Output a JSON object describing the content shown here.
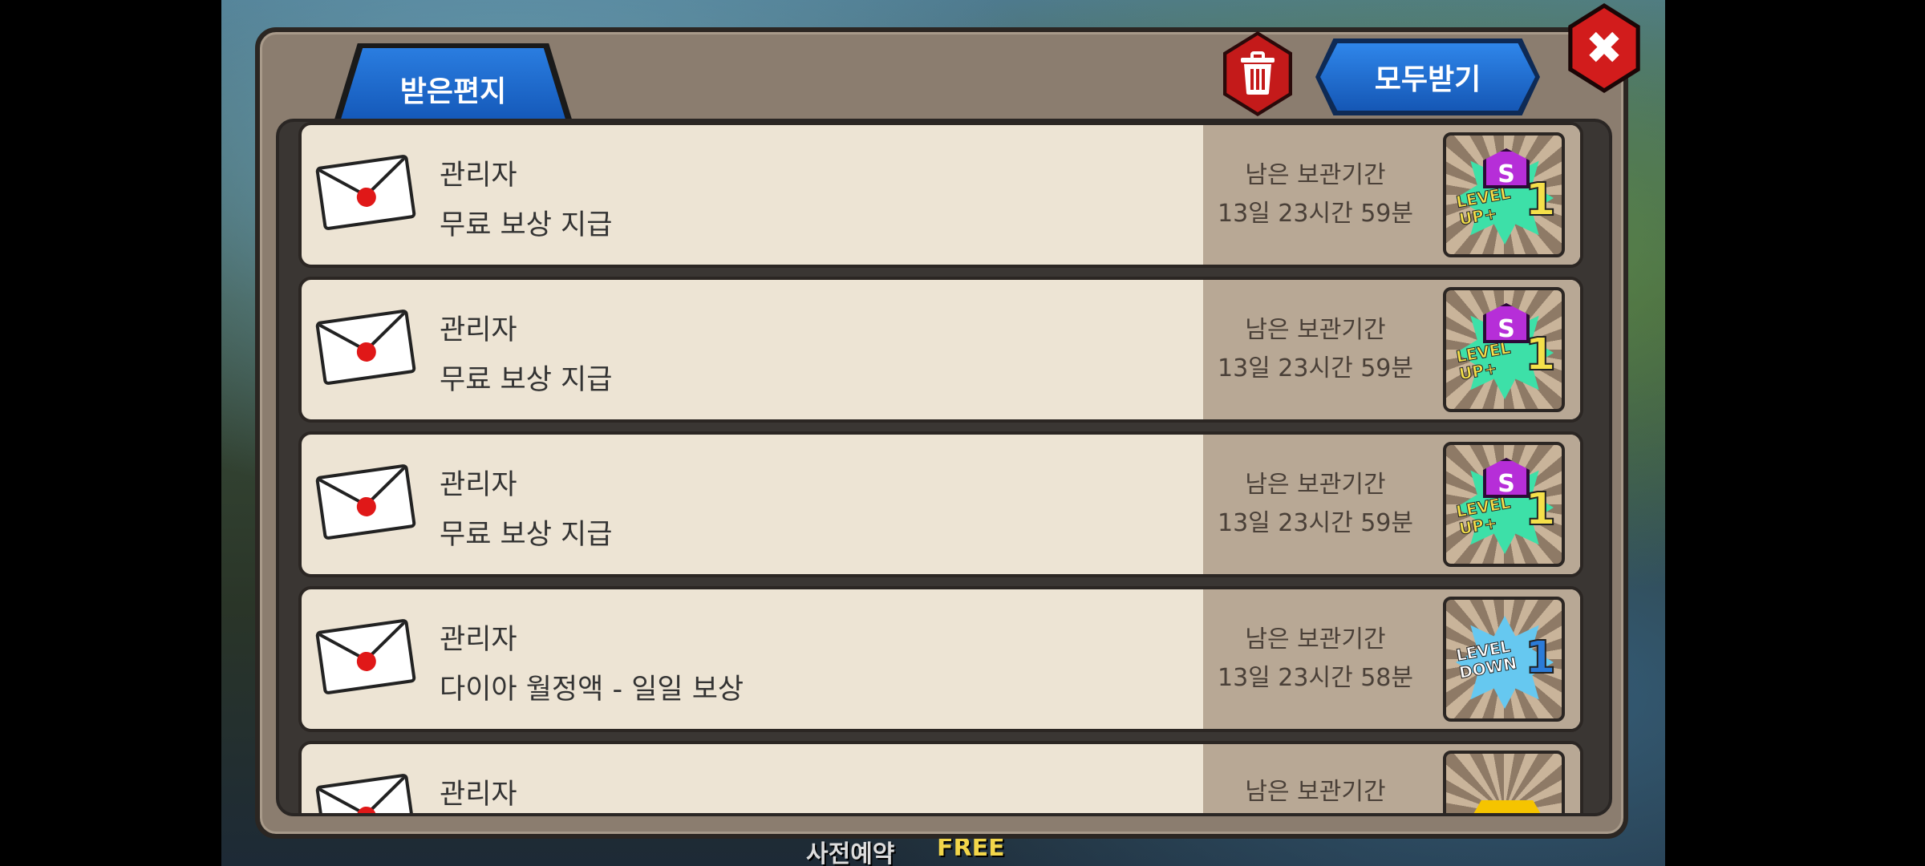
{
  "popup": {
    "tab_label": "받은편지",
    "claim_all_label": "모두받기",
    "trash_icon": "trash-icon",
    "close_icon": "close-icon",
    "close_glyph": "✖"
  },
  "mail_list": [
    {
      "sender": "관리자",
      "subject": "무료 보상 지급",
      "expiry_label": "남은 보관기간",
      "expiry_time": "13일 23시간 59분",
      "reward": {
        "icon": "level-up-ticket-icon",
        "badge": "S",
        "text_line1": "LEVEL",
        "text_line2": "UP+",
        "number": "1"
      }
    },
    {
      "sender": "관리자",
      "subject": "무료 보상 지급",
      "expiry_label": "남은 보관기간",
      "expiry_time": "13일 23시간 59분",
      "reward": {
        "icon": "level-up-ticket-icon",
        "badge": "S",
        "text_line1": "LEVEL",
        "text_line2": "UP+",
        "number": "1"
      }
    },
    {
      "sender": "관리자",
      "subject": "무료 보상 지급",
      "expiry_label": "남은 보관기간",
      "expiry_time": "13일 23시간 59분",
      "reward": {
        "icon": "level-up-ticket-icon",
        "badge": "S",
        "text_line1": "LEVEL",
        "text_line2": "UP+",
        "number": "1"
      }
    },
    {
      "sender": "관리자",
      "subject": "다이아 월정액 - 일일 보상",
      "expiry_label": "남은 보관기간",
      "expiry_time": "13일 23시간 58분",
      "reward": {
        "icon": "level-down-ticket-icon",
        "text_line1": "LEVEL",
        "text_line2": "DOWN",
        "number": "1"
      }
    },
    {
      "sender": "관리자",
      "subject": "",
      "expiry_label": "남은 보관기간",
      "expiry_time": "",
      "reward": {
        "icon": "diamond-icon"
      }
    }
  ],
  "background": {
    "caption": "사전예약",
    "free_label": "FREE"
  },
  "colors": {
    "tab_blue": "#1a6ad0",
    "trash_red": "#c41a1a",
    "close_red": "#d21c1c",
    "row_bg": "#ede4d4",
    "panel_frame": "#8b7d6f"
  }
}
